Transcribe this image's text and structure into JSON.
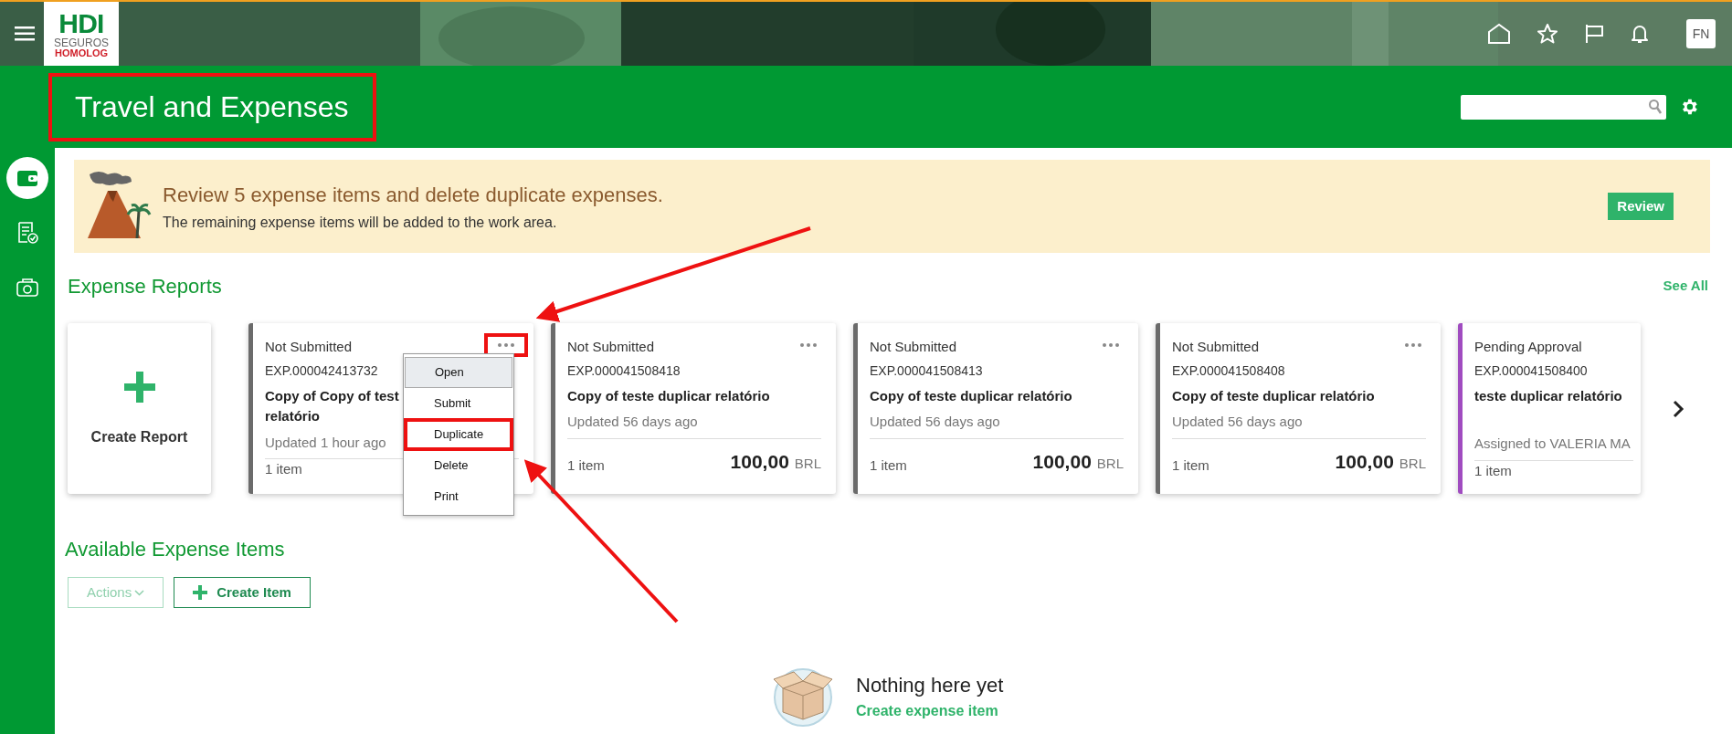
{
  "top_bar": {
    "logo": {
      "brand": "HDI",
      "subtitle": "SEGUROS",
      "environment": "HOMOLOG"
    },
    "avatar": "FN"
  },
  "header": {
    "title": "Travel and Expenses",
    "title_annotated": true
  },
  "sidebar": {
    "items": [
      {
        "selected": true
      },
      {
        "selected": false
      },
      {
        "selected": false
      }
    ]
  },
  "banner": {
    "title": "Review 5 expense items and delete duplicate expenses.",
    "message": "The remaining expense items will be added to the work area.",
    "button": "Review"
  },
  "expense_reports": {
    "heading": "Expense Reports",
    "see_all": "See All",
    "cards": [
      {
        "kind": "create",
        "label": "Create Report"
      },
      {
        "kind": "report",
        "color": "#6b6b6b",
        "status": "Not Submitted",
        "id": "EXP.000042413732",
        "title_lines": [
          "Copy of Copy of test",
          "relatório"
        ],
        "updated": "Updated 1 hour ago",
        "count": "1 item",
        "more_annotated": true,
        "menu": [
          {
            "label": "Open",
            "selected": true,
            "annotated": false
          },
          {
            "label": "Submit",
            "selected": false,
            "annotated": false
          },
          {
            "label": "Duplicate",
            "selected": false,
            "annotated": true
          },
          {
            "label": "Delete",
            "selected": false,
            "annotated": false
          },
          {
            "label": "Print",
            "selected": false,
            "annotated": false
          }
        ]
      },
      {
        "kind": "report",
        "color": "#6b6b6b",
        "status": "Not Submitted",
        "id": "EXP.000041508418",
        "title_lines": [
          "Copy of teste duplicar relatório"
        ],
        "updated": "Updated 56 days ago",
        "count": "1 item",
        "amount": "100,00",
        "currency": "BRL",
        "more_annotated": false
      },
      {
        "kind": "report",
        "color": "#6b6b6b",
        "status": "Not Submitted",
        "id": "EXP.000041508413",
        "title_lines": [
          "Copy of teste duplicar relatório"
        ],
        "updated": "Updated 56 days ago",
        "count": "1 item",
        "amount": "100,00",
        "currency": "BRL",
        "more_annotated": false
      },
      {
        "kind": "report",
        "color": "#6b6b6b",
        "status": "Not Submitted",
        "id": "EXP.000041508408",
        "title_lines": [
          "Copy of teste duplicar relatório"
        ],
        "updated": "Updated 56 days ago",
        "count": "1 item",
        "amount": "100,00",
        "currency": "BRL",
        "more_annotated": false
      },
      {
        "kind": "report",
        "color": "#a04cc0",
        "status": "Pending Approval",
        "id": "EXP.000041508400",
        "title_lines": [
          "teste duplicar relatório"
        ],
        "assigned": "Assigned to VALERIA MA",
        "count": "1 item"
      }
    ]
  },
  "available_items": {
    "heading": "Available Expense Items",
    "actions": {
      "label": "Actions",
      "disabled": true
    },
    "create_button": "Create Item",
    "empty": {
      "title": "Nothing here yet",
      "link": "Create expense item"
    }
  }
}
